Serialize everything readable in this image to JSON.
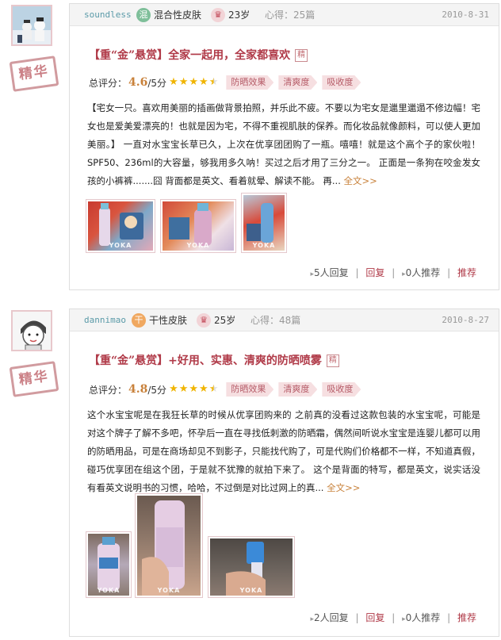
{
  "reviews": [
    {
      "username": "soundless",
      "skin_icon": "混",
      "skin_type": "混合性皮肤",
      "skin_color": "#7fbf9a",
      "age": "23岁",
      "xinde_label": "心得：",
      "xinde_count": "25篇",
      "date": "2010-8-31",
      "badge": "精华",
      "title": "【重“金”悬赏】全家一起用，全家都喜欢",
      "title_tag": "精",
      "rating_label": "总评分：",
      "score": "4.6",
      "outof": "/5分",
      "tags": [
        "防晒效果",
        "清爽度",
        "吸收度"
      ],
      "body": "【宅女一只。喜欢用美丽的插画做背景拍照，并乐此不疲。不要以为宅女是邋里邋遢不修边幅！宅女也是爱美爱漂亮的！也就是因为宅，不得不重视肌肤的保养。而化妆品就像颜料，可以使人更加美丽。】 一直对水宝宝长草已久，上次在优享团团购了一瓶。嘻嘻！就是这个高个子的家伙啦！ SPF50、236ml的大容量，够我用多久呐！买过之后才用了三分之一。 正面是一条狗在咬金发女孩的小裤裤.......囧 背面都是英文、看着就晕、解读不能。 再...",
      "more": "全文>>",
      "replies": "5人回复",
      "reply_label": "回复",
      "recommends": "0人推荐",
      "recommend_label": "推荐"
    },
    {
      "username": "dannimao",
      "skin_icon": "干",
      "skin_type": "干性皮肤",
      "skin_color": "#f0a860",
      "age": "25岁",
      "xinde_label": "心得：",
      "xinde_count": "48篇",
      "date": "2010-8-27",
      "badge": "精华",
      "title": "【重“金”悬赏】+好用、实惠、清爽的防晒喷雾",
      "title_tag": "精",
      "rating_label": "总评分：",
      "score": "4.8",
      "outof": "/5分",
      "tags": [
        "防晒效果",
        "清爽度",
        "吸收度"
      ],
      "body": "这个水宝宝呢是在我狂长草的时候从优享团购来的 之前真的没看过这款包装的水宝宝呢，可能是对这个牌子了解不多吧，怀孕后一直在寻找低刺激的防晒霜，偶然间听说水宝宝是连婴儿都可以用的防晒用品，可是在商场却见不到影子，只能找代购了，可是代购们价格都不一样，不知道真假，碰巧优享团在组这个团，于是就不犹豫的就拍下来了。 这个是背面的特写，都是英文，说实话没有看英文说明书的习惯，哈哈，不过倒是对比过网上的真...",
      "more": "全文>>",
      "replies": "2人回复",
      "reply_label": "回复",
      "recommends": "0人推荐",
      "recommend_label": "推荐"
    }
  ],
  "photo_watermark": "YOKA",
  "colors": {
    "accent": "#b03a48",
    "gold": "#c8813a",
    "tag_bg": "#f6dfe1"
  }
}
